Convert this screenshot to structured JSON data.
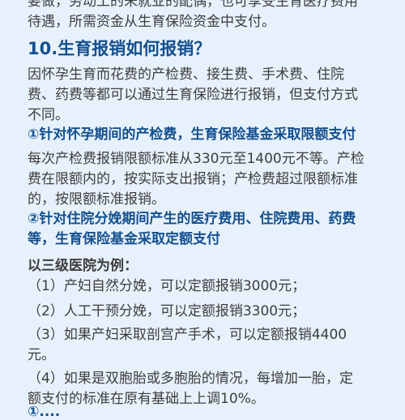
{
  "top_partial": {
    "line1": "要做，劳动工的未就业的配偶，也可享受生育医疗费用",
    "line2": "待遇，所需资金从生育保险资金中支付。"
  },
  "section": {
    "title": "10.生育报销如何报销？",
    "intro": [
      "因怀孕生育而花费的产检费、接生费、手术费、住院",
      "费、药费等都可以通过生育保险进行报销，但支付方式",
      "不同。"
    ],
    "point1_heading": "①针对怀孕期间的产检费，生育保险基金采取限额支付",
    "point1_body": [
      "每次产检费报销限额标准从330元至1400元不等。产检",
      "费在限额内的，按实际支出报销；产检费超过限额标准",
      "的，按限额标准报销。"
    ],
    "point2_heading": [
      "②针对住院分娩期间产生的医疗费用、住院费用、药费",
      "等，生育保险基金采取定额支付"
    ],
    "example_lead": "以三级医院为例：",
    "items": [
      [
        "（1）产妇自然分娩，可以定额报销3000元；"
      ],
      [
        "（2）人工干预分娩，可以定额报销3300元；"
      ],
      [
        "（3）如果产妇采取剖宫产手术，可以定额报销4400",
        "元。"
      ],
      [
        "（4）如果是双胞胎或多胞胎的情况，每增加一胎，定",
        "额支付的标准在原有基础上上调10%。"
      ]
    ],
    "bottom_partial": "①...."
  },
  "colors": {
    "background": "#e7f1fb",
    "heading": "#14508f",
    "body": "#3d3d3d"
  }
}
